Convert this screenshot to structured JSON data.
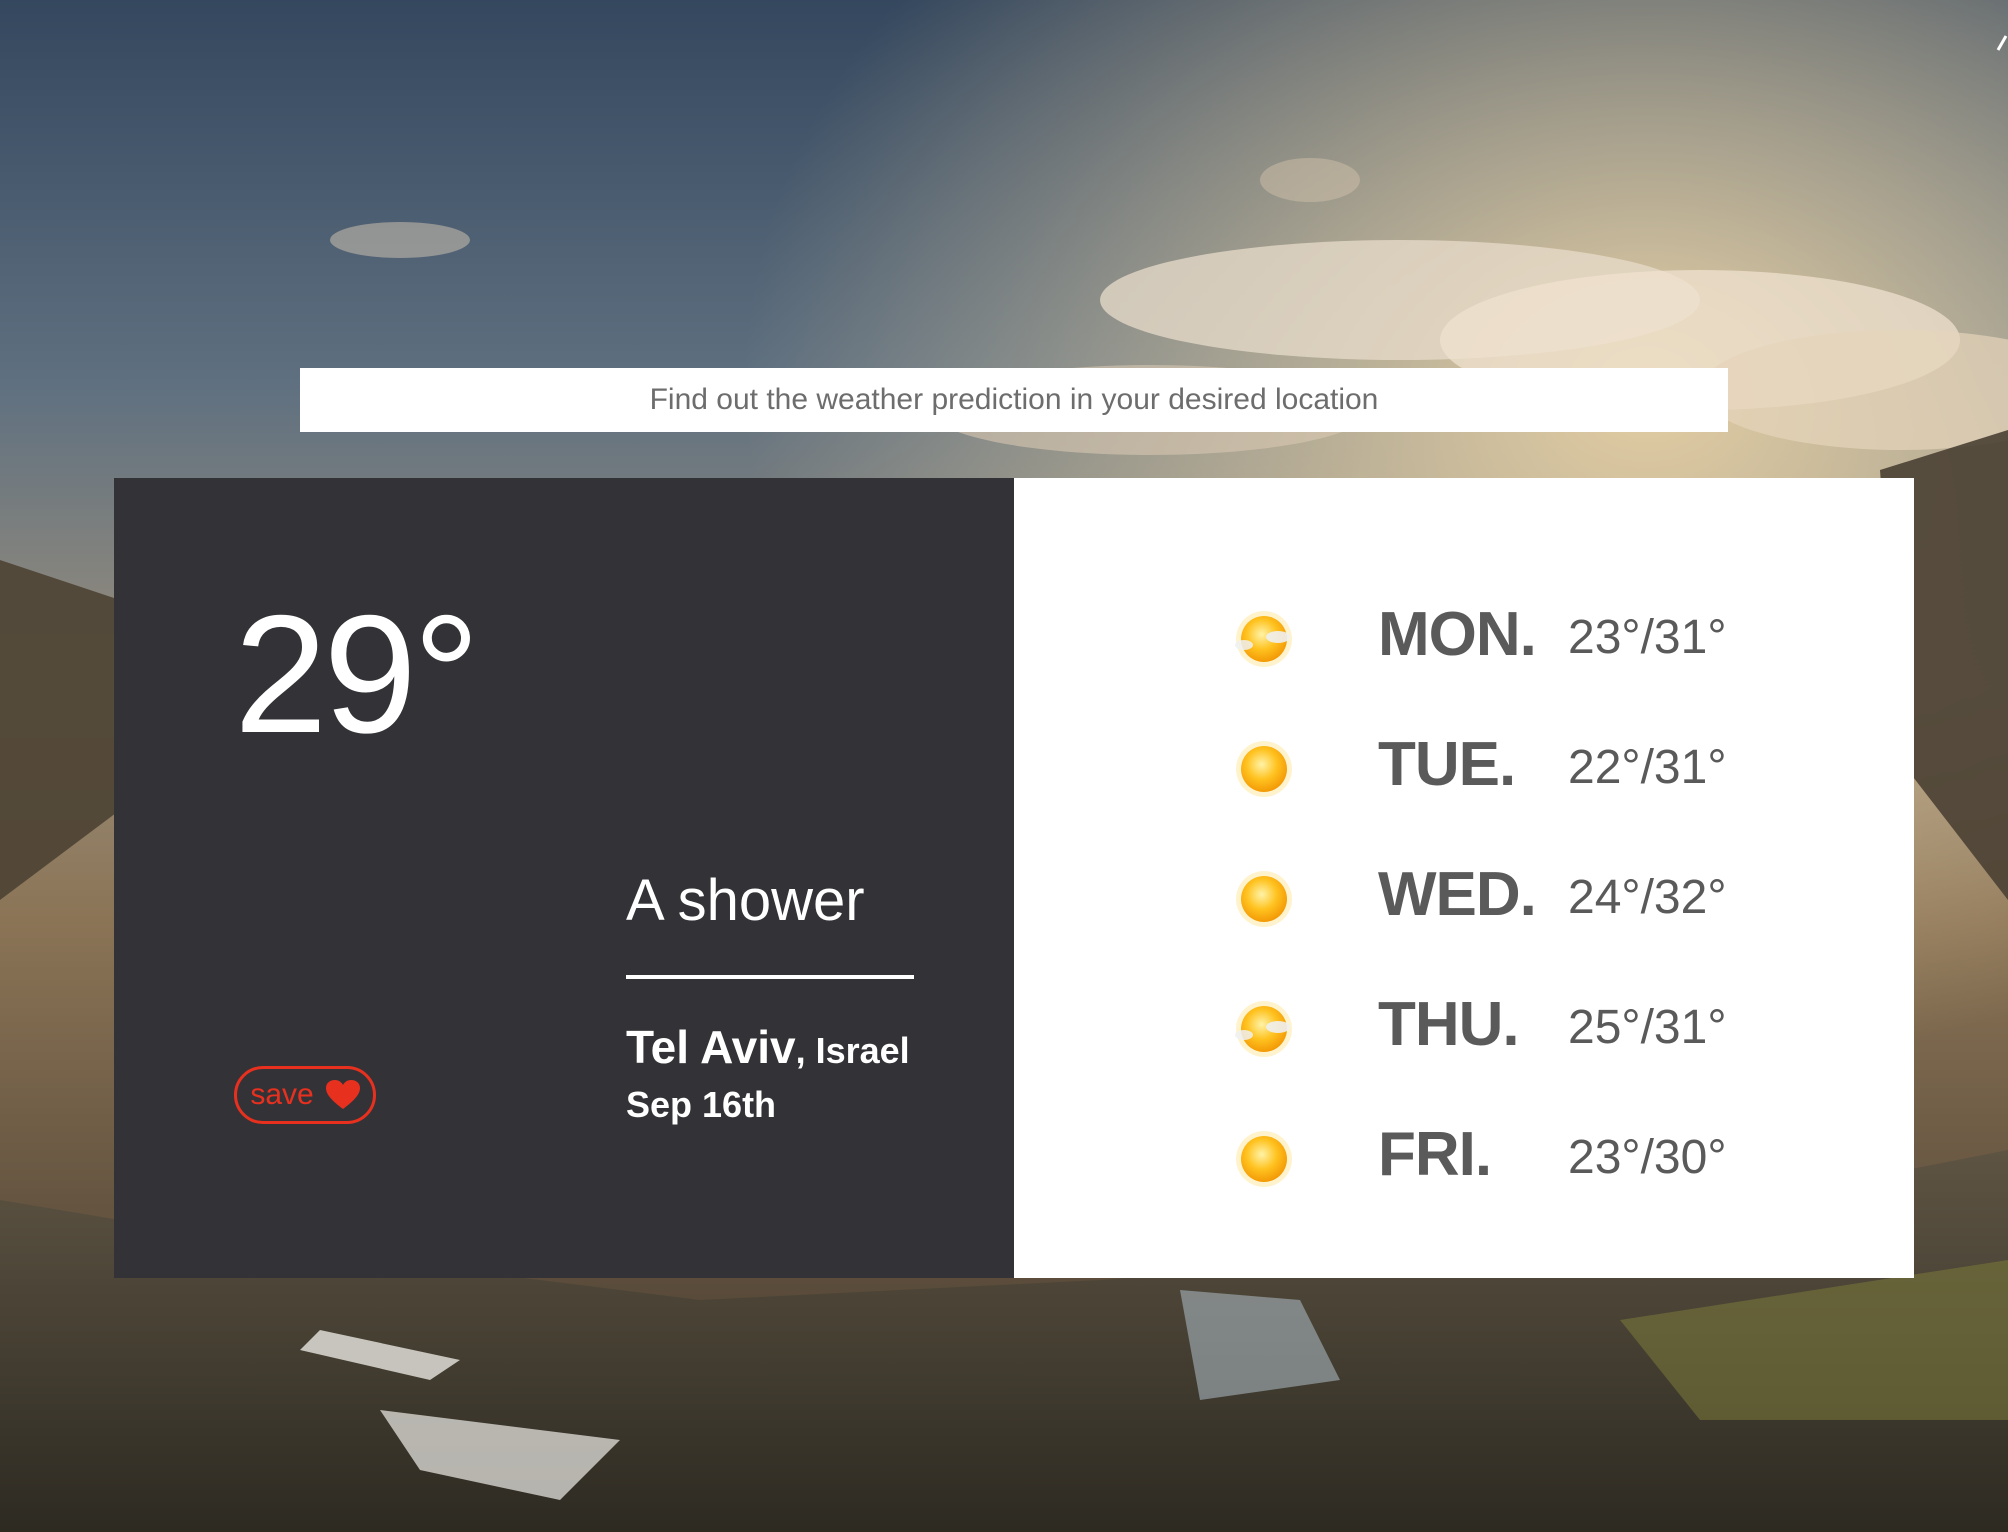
{
  "search": {
    "placeholder": "Find out the weather prediction in your desired location"
  },
  "current": {
    "temperature": "29°",
    "condition": "A shower",
    "city": "Tel Aviv",
    "country": ", Israel",
    "date": "Sep 16th",
    "save_label": "save"
  },
  "forecast": [
    {
      "day": "MON.",
      "temps": "23°/31°",
      "icon": "sun-cloud-icon"
    },
    {
      "day": "TUE.",
      "temps": "22°/31°",
      "icon": "sun-icon"
    },
    {
      "day": "WED.",
      "temps": "24°/32°",
      "icon": "sun-icon"
    },
    {
      "day": "THU.",
      "temps": "25°/31°",
      "icon": "sun-cloud-icon"
    },
    {
      "day": "FRI.",
      "temps": "23°/30°",
      "icon": "sun-icon"
    }
  ],
  "colors": {
    "dark_card": "#333337",
    "accent_red": "#e8301f",
    "text_gray": "#5a5a5a"
  }
}
